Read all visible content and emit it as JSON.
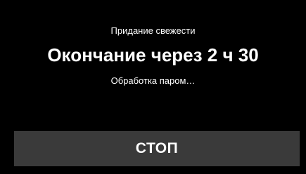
{
  "program": {
    "mode_label": "Придание свежести",
    "remaining_text": "Окончание через 2 ч 30",
    "status_text": "Обработка паром…"
  },
  "controls": {
    "stop_label": "СТОП"
  },
  "colors": {
    "background": "#000000",
    "text": "#ffffff",
    "button_background": "#3a3a3a"
  }
}
